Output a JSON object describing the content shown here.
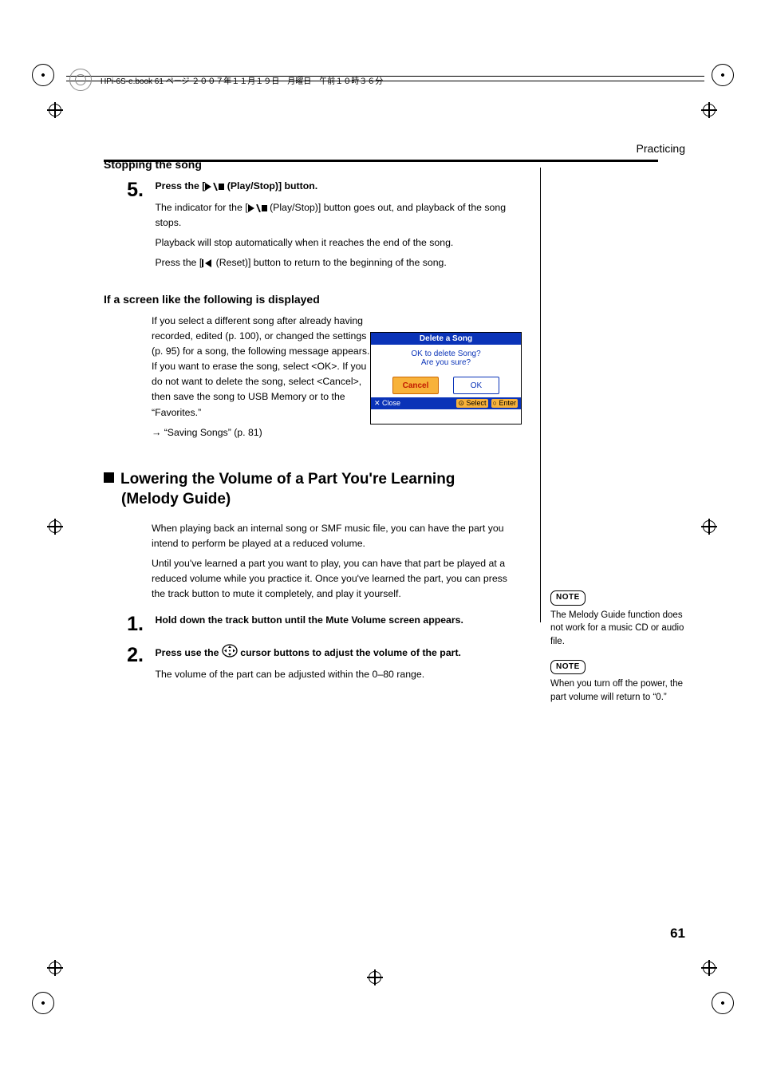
{
  "meta": {
    "book_line": "HPi-6S-e.book  61 ページ  ２００７年１１月１９日　月曜日　午前１０時３６分"
  },
  "header": {
    "section": "Practicing"
  },
  "stopping": {
    "title": "Stopping the song",
    "step_num": "5.",
    "instr_pre": "Press the [",
    "instr_post": " (Play/Stop)] button.",
    "p1_pre": "The indicator for the [",
    "p1_post": " (Play/Stop)] button goes out, and playback of the song stops.",
    "p2": "Playback will stop automatically when it reaches the end of the song.",
    "p3_pre": "Press the [",
    "p3_post": " (Reset)] button to return to the beginning of the song."
  },
  "ifscreen": {
    "title": "If a screen like the following is displayed",
    "body": "If you select a different song after already having recorded, edited (p. 100), or changed the settings (p. 95) for a song, the following message appears. If you want to erase the song, select <OK>. If you do not want to delete the song, select <Cancel>, then save the song to USB Memory or to the “Favorites.”",
    "ref": "→ “Saving Songs” (p. 81)"
  },
  "dialog": {
    "title": "Delete a Song",
    "line1": "OK to delete Song?",
    "line2": "Are you sure?",
    "cancel": "Cancel",
    "ok": "OK",
    "close": "✕ Close",
    "select": "⊙ Select",
    "enter": "○ Enter"
  },
  "melody": {
    "title_line1": "Lowering the Volume of a Part You're Learning",
    "title_line2": "(Melody Guide)",
    "p1": "When playing back an internal song or SMF music file, you can have the part you intend to perform be played at a reduced volume.",
    "p2": "Until you've learned a part you want to play, you can have that part be played at a reduced volume while you practice it. Once you've learned the part, you can press the track button to mute it completely, and play it yourself.",
    "step1_num": "1.",
    "step1_instr": "Hold down the track button until the Mute Volume screen appears.",
    "step2_num": "2.",
    "step2_instr_pre": "Press use the ",
    "step2_instr_post": " cursor buttons to adjust the volume of the part.",
    "step2_body": "The volume of the part can be adjusted within the 0–80 range."
  },
  "sidebar": {
    "note_label": "NOTE",
    "note1": "The Melody Guide function does not work for a music CD or audio file.",
    "note2": "When you turn off the power, the part volume will return to “0.”"
  },
  "page_number": "61"
}
